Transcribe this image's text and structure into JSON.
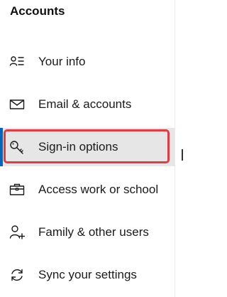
{
  "section": {
    "title": "Accounts"
  },
  "nav": {
    "items": [
      {
        "label": "Your info",
        "icon": "person-list-icon",
        "selected": false
      },
      {
        "label": "Email & accounts",
        "icon": "mail-icon",
        "selected": false
      },
      {
        "label": "Sign-in options",
        "icon": "key-icon",
        "selected": true
      },
      {
        "label": "Access work or school",
        "icon": "briefcase-icon",
        "selected": false
      },
      {
        "label": "Family & other users",
        "icon": "person-add-icon",
        "selected": false
      },
      {
        "label": "Sync your settings",
        "icon": "sync-icon",
        "selected": false
      }
    ]
  },
  "colors": {
    "highlight_border": "#e03c46",
    "selected_background": "#e6e6e6",
    "accent": "#0067c0",
    "text": "#1a1a1a"
  }
}
